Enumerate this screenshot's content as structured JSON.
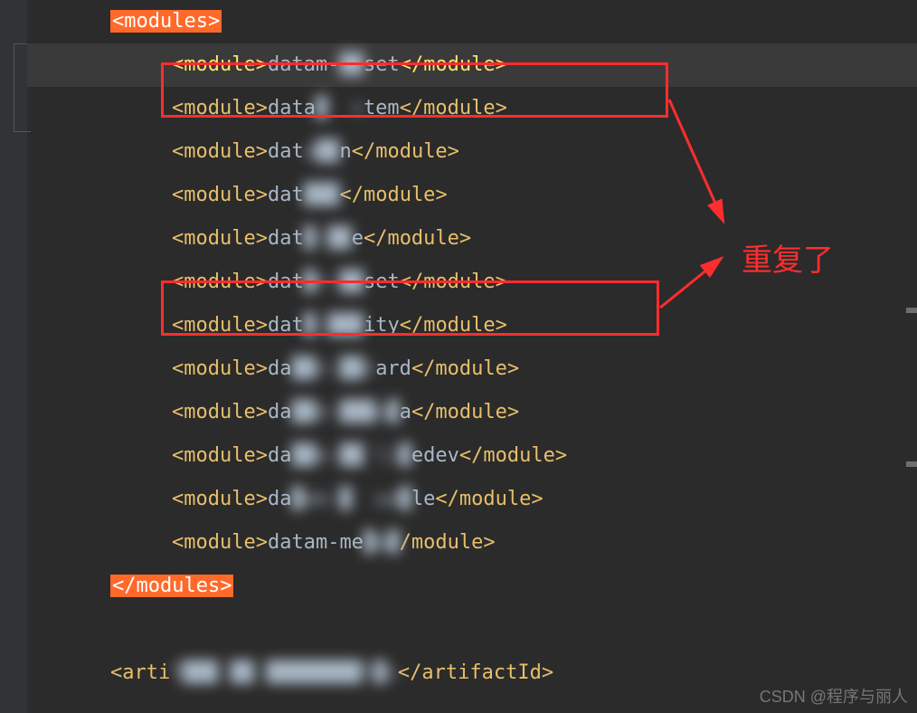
{
  "tags": {
    "modules_open": "<modules>",
    "modules_close": "</modules>",
    "mod_open": "<module>",
    "mod_close": "</module>",
    "artifact_close": "</artifactId>"
  },
  "lines": {
    "l1": {
      "pre": "datam-",
      "blur": "██",
      "post": "set"
    },
    "l2": {
      "pre": "data",
      "blur": "█  s",
      "post": "tem"
    },
    "l3": {
      "pre": "dat",
      "blur": "a██",
      "post": "n"
    },
    "l4": {
      "pre": "dat",
      "blur": "███",
      "post": ""
    },
    "l5": {
      "pre": "dat",
      "blur": "█-██",
      "post": "e"
    },
    "l6": {
      "pre": "dat",
      "blur": "█n-██",
      "post": "set"
    },
    "l7": {
      "pre": "dat",
      "blur": "█-███",
      "post": "ity"
    },
    "l8": {
      "pre": "da",
      "blur": "██n-██n",
      "post": "ard"
    },
    "l9": {
      "pre": "da",
      "blur": "██m-███u█",
      "post": "a"
    },
    "l10": {
      "pre": "da",
      "blur": "██m-██ li█",
      "post": "edev"
    },
    "l11": {
      "pre": "da",
      "blur": "█am-█  wa█",
      "post": "le"
    },
    "l12": {
      "pre": "datam-me",
      "blur": "█a█",
      "post": ""
    },
    "artifact": {
      "pre": "<arti",
      "blur": "f███ ██ ████████l█s",
      "post": ""
    }
  },
  "annotation": "重复了",
  "watermark": "CSDN @程序与丽人"
}
